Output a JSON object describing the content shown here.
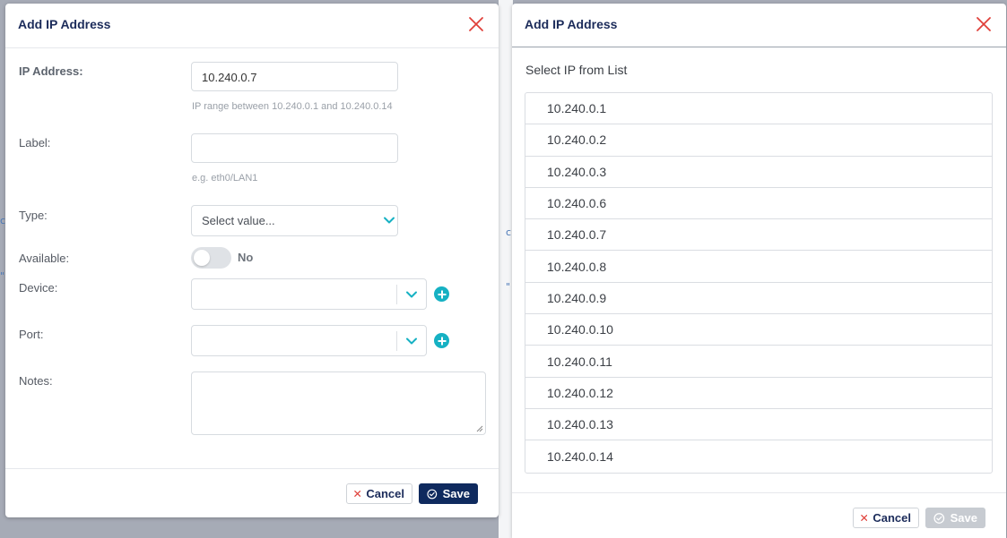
{
  "background": {
    "marks": [
      "c",
      "\"",
      "c",
      "\""
    ]
  },
  "left_modal": {
    "title": "Add IP Address",
    "fields": {
      "ip_address": {
        "label": "IP Address:",
        "value": "10.240.0.7",
        "hint": "IP range between 10.240.0.1 and 10.240.0.14"
      },
      "label": {
        "label": "Label:",
        "value": "",
        "hint": "e.g. eth0/LAN1"
      },
      "type": {
        "label": "Type:",
        "placeholder": "Select value..."
      },
      "available": {
        "label": "Available:",
        "state_text": "No"
      },
      "device": {
        "label": "Device:",
        "value": ""
      },
      "port": {
        "label": "Port:",
        "value": ""
      },
      "notes": {
        "label": "Notes:",
        "value": ""
      }
    },
    "footer": {
      "cancel_label": "Cancel",
      "save_label": "Save"
    }
  },
  "right_modal": {
    "title": "Add IP Address",
    "list_heading": "Select IP from List",
    "ip_options": [
      "10.240.0.1",
      "10.240.0.2",
      "10.240.0.3",
      "10.240.0.6",
      "10.240.0.7",
      "10.240.0.8",
      "10.240.0.9",
      "10.240.0.10",
      "10.240.0.11",
      "10.240.0.12",
      "10.240.0.13",
      "10.240.0.14"
    ],
    "footer": {
      "cancel_label": "Cancel",
      "save_label": "Save"
    }
  },
  "colors": {
    "accent_navy": "#0f2a5e",
    "close_red": "#e0403a",
    "teal": "#16b1c3",
    "chevron_teal": "#16b1c3",
    "disabled_gray": "#c7cbd1"
  },
  "icons": {
    "close": "close-icon",
    "chevron": "chevron-down-icon",
    "add": "plus-circle-icon",
    "cancel_x": "x-icon",
    "save_check": "check-circle-icon"
  }
}
